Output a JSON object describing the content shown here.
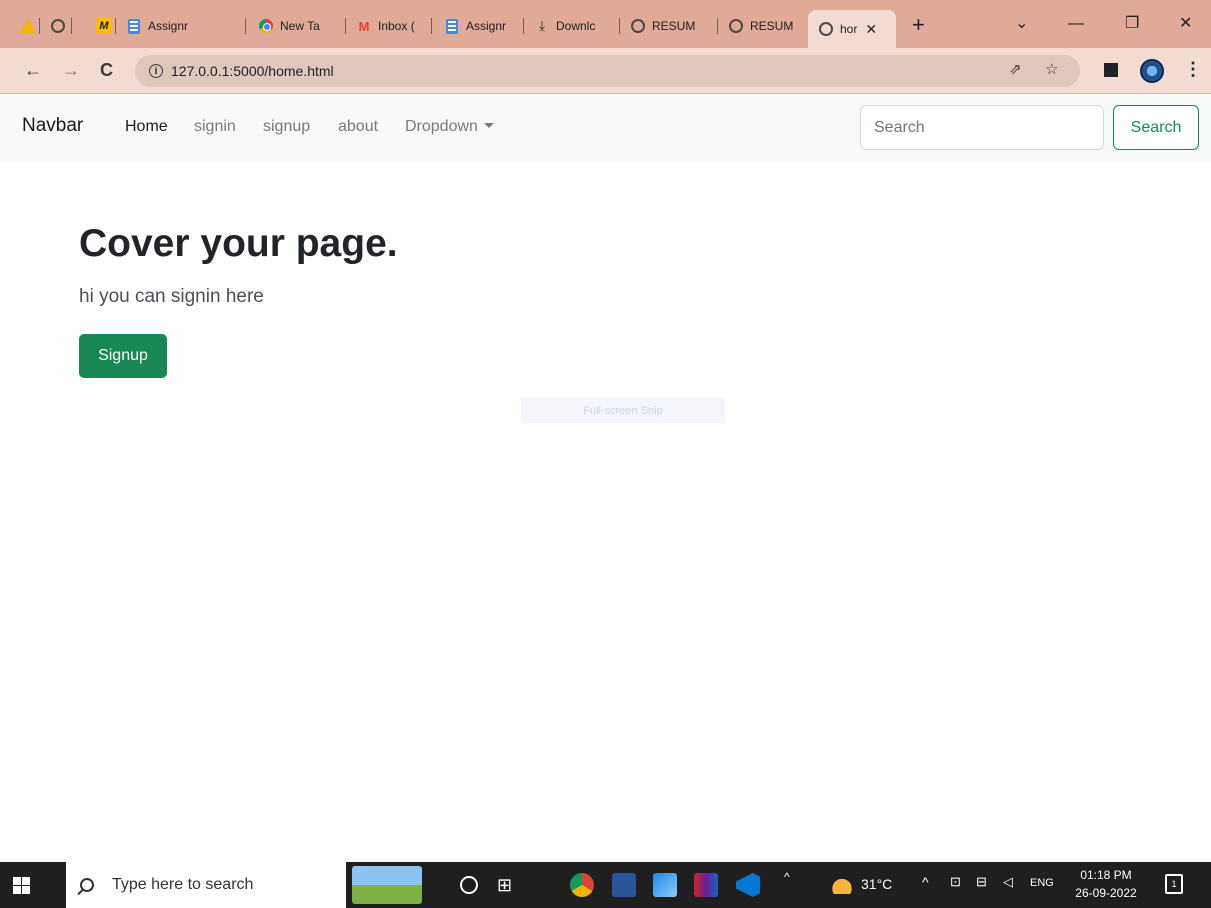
{
  "browser": {
    "tabs": [
      {
        "label": "",
        "icon": "google-drive-icon"
      },
      {
        "label": "",
        "icon": "globe-icon"
      },
      {
        "label": "",
        "icon": "miro-icon"
      },
      {
        "label": "Assignr",
        "icon": "google-docs-icon"
      },
      {
        "label": "New Ta",
        "icon": "chrome-icon"
      },
      {
        "label": "Inbox (",
        "icon": "gmail-icon"
      },
      {
        "label": "Assignr",
        "icon": "google-docs-icon"
      },
      {
        "label": "Downlc",
        "icon": "download-icon"
      },
      {
        "label": "RESUM",
        "icon": "globe-icon"
      },
      {
        "label": "RESUM",
        "icon": "globe-icon"
      },
      {
        "label": "hor",
        "icon": "globe-icon",
        "active": true
      }
    ],
    "close_tab_glyph": "✕",
    "new_tab_glyph": "+",
    "window_controls": {
      "tab_search": "⌄",
      "minimize": "—",
      "restore": "❐",
      "close": "✕"
    },
    "url": "127.0.0.1:5000/home.html",
    "info_glyph": "i",
    "toolbar_glyphs": {
      "back": "←",
      "forward": "→",
      "reload": "C",
      "share": "⇗",
      "star": "☆",
      "menu": "⋮"
    }
  },
  "navbar": {
    "brand": "Navbar",
    "links": [
      {
        "label": "Home",
        "active": true
      },
      {
        "label": "signin"
      },
      {
        "label": "signup"
      },
      {
        "label": "about"
      },
      {
        "label": "Dropdown",
        "dropdown": true
      }
    ],
    "search_placeholder": "Search",
    "search_button": "Search"
  },
  "hero": {
    "title": "Cover your page.",
    "lead": "hi you can signin here",
    "button": "Signup"
  },
  "overlay": {
    "snip_hint": "Full-screen Snip"
  },
  "taskbar": {
    "search_placeholder": "Type here to search",
    "weather": "31°C",
    "tray_up_glyph": "^",
    "language": "ENG",
    "time": "01:18 PM",
    "date": "26-09-2022",
    "notification_count": "1"
  },
  "colors": {
    "tabstrip_bg": "#e0a998",
    "toolbar_bg": "#f2dbd2",
    "success": "#198754",
    "navbar_bg": "#f8f9fa",
    "taskbar_bg": "#1f1f1f"
  }
}
